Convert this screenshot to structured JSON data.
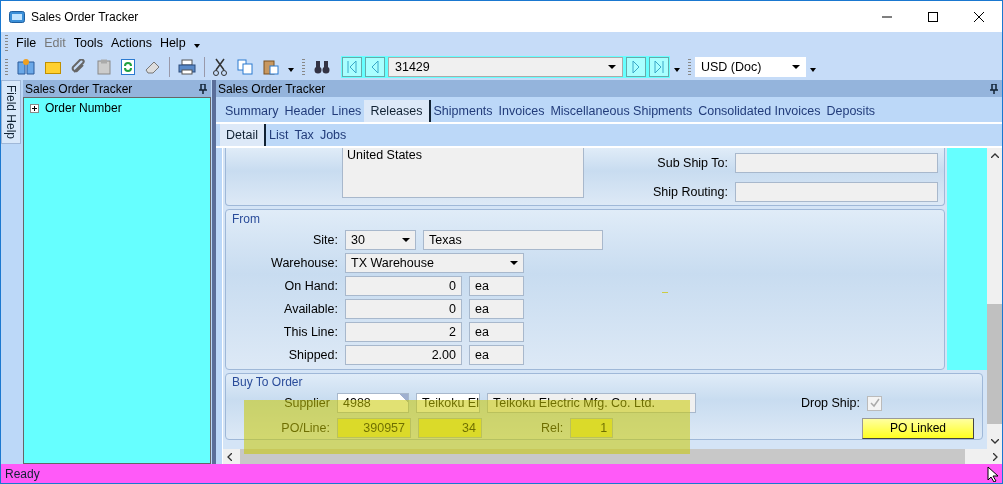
{
  "window": {
    "title": "Sales Order Tracker"
  },
  "menu": [
    {
      "label": "File",
      "disabled": false
    },
    {
      "label": "Edit",
      "disabled": true
    },
    {
      "label": "Tools",
      "disabled": false
    },
    {
      "label": "Actions",
      "disabled": false
    },
    {
      "label": "Help",
      "disabled": false
    }
  ],
  "toolbar": {
    "order_number": "31429",
    "currency": "USD (Doc)"
  },
  "field_help_tab": "Field Help",
  "tree_panel": {
    "title": "Sales Order Tracker",
    "items": [
      {
        "label": "Order Number",
        "expanded": false
      }
    ]
  },
  "main_panel": {
    "title": "Sales Order Tracker",
    "tabs": [
      {
        "label": "Summary",
        "selected": false
      },
      {
        "label": "Header",
        "selected": false
      },
      {
        "label": "Lines",
        "selected": false
      },
      {
        "label": "Releases",
        "selected": true
      },
      {
        "label": "Shipments",
        "selected": false
      },
      {
        "label": "Invoices",
        "selected": false
      },
      {
        "label": "Miscellaneous Shipments",
        "selected": false
      },
      {
        "label": "Consolidated Invoices",
        "selected": false
      },
      {
        "label": "Deposits",
        "selected": false
      }
    ],
    "subtabs": [
      {
        "label": "Detail",
        "selected": true
      },
      {
        "label": "List",
        "selected": false
      },
      {
        "label": "Tax",
        "selected": false
      },
      {
        "label": "Jobs",
        "selected": false
      }
    ]
  },
  "ship_to": {
    "address": "United States",
    "sub_ship_to_label": "Sub Ship To:",
    "ship_routing_label": "Ship Routing:"
  },
  "from": {
    "title": "From",
    "site_label": "Site:",
    "site": "30",
    "site_name": "Texas",
    "warehouse_label": "Warehouse:",
    "warehouse": "TX Warehouse",
    "quantities": [
      {
        "label": "On Hand:",
        "value": "0",
        "uom": "ea"
      },
      {
        "label": "Available:",
        "value": "0",
        "uom": "ea"
      },
      {
        "label": "This Line:",
        "value": "2",
        "uom": "ea"
      },
      {
        "label": "Shipped:",
        "value": "2.00",
        "uom": "ea"
      }
    ]
  },
  "buy_to_order": {
    "title": "Buy To Order",
    "highlighted": true,
    "supplier_label": "Supplier",
    "supplier": "4988",
    "supplier_short": "Teikoku El",
    "supplier_name": "Teikoku Electric Mfg. Co. Ltd.",
    "drop_ship": {
      "label": "Drop Ship:",
      "checked": true,
      "disabled": true
    },
    "po_line_label": "PO/Line:",
    "po": "390957",
    "line": "34",
    "rel_label": "Rel:",
    "rel": "1",
    "linked_button": "PO Linked"
  },
  "status_bar": {
    "text": "Ready"
  }
}
